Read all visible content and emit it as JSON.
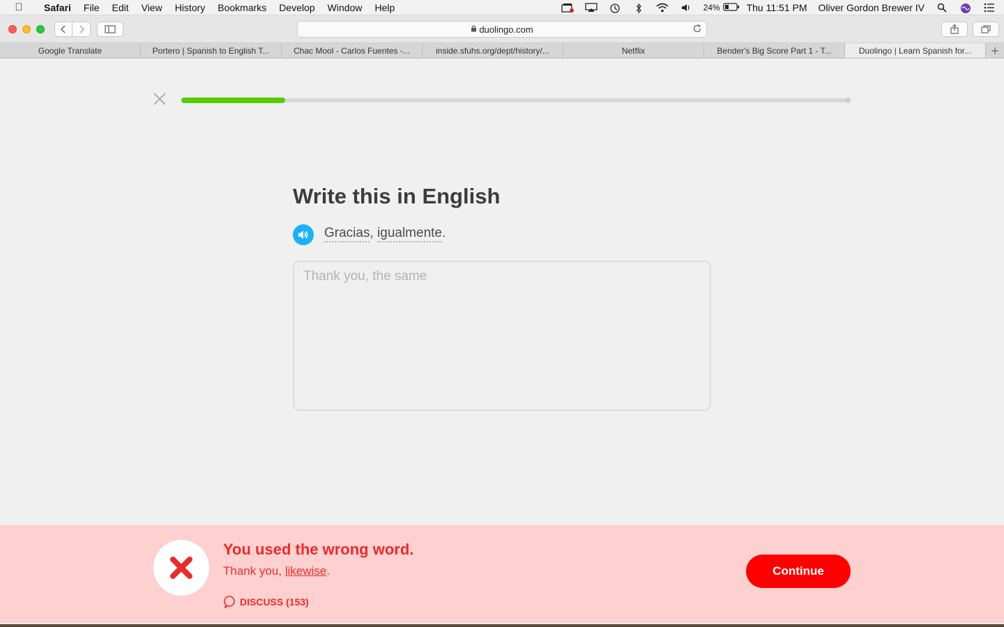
{
  "menubar": {
    "app_name": "Safari",
    "items": [
      "File",
      "Edit",
      "View",
      "History",
      "Bookmarks",
      "Develop",
      "Window",
      "Help"
    ],
    "battery": "24%",
    "clock": "Thu 11:51 PM",
    "user": "Oliver Gordon Brewer IV",
    "status_icons": [
      "screen-record-icon",
      "airplay-icon",
      "time-machine-icon",
      "bluetooth-icon",
      "wifi-icon",
      "volume-icon",
      "battery-icon",
      "spotlight-icon",
      "siri-icon",
      "notification-center-icon"
    ]
  },
  "toolbar": {
    "url": "duolingo.com"
  },
  "tabs": [
    {
      "label": "Google Translate",
      "active": false
    },
    {
      "label": "Portero | Spanish to English T...",
      "active": false
    },
    {
      "label": "Chac Mool - Carlos Fuentes -...",
      "active": false
    },
    {
      "label": "inside.sfuhs.org/dept/history/...",
      "active": false
    },
    {
      "label": "Netflix",
      "active": false
    },
    {
      "label": "Bender's Big Score Part 1 - T...",
      "active": false
    },
    {
      "label": "Duolingo | Learn Spanish for...",
      "active": true
    }
  ],
  "lesson": {
    "progress_fraction": 0.156,
    "title": "Write this in English",
    "sentence_words": [
      "Gracias",
      "igualmente"
    ],
    "sentence_sep": ", ",
    "sentence_end": ".",
    "answer_value": "Thank you, the same"
  },
  "feedback": {
    "title": "You used the wrong word.",
    "answer_prefix": "Thank you, ",
    "answer_highlight": "likewise",
    "answer_suffix": ".",
    "discuss_label": "DISCUSS (153)",
    "continue_label": "Continue"
  },
  "colors": {
    "progress": "#58cc02",
    "speaker": "#1cb0f6",
    "error_text": "#ea2b2b",
    "error_bg": "#ffd0d0",
    "continue_bg": "#ff0000"
  }
}
